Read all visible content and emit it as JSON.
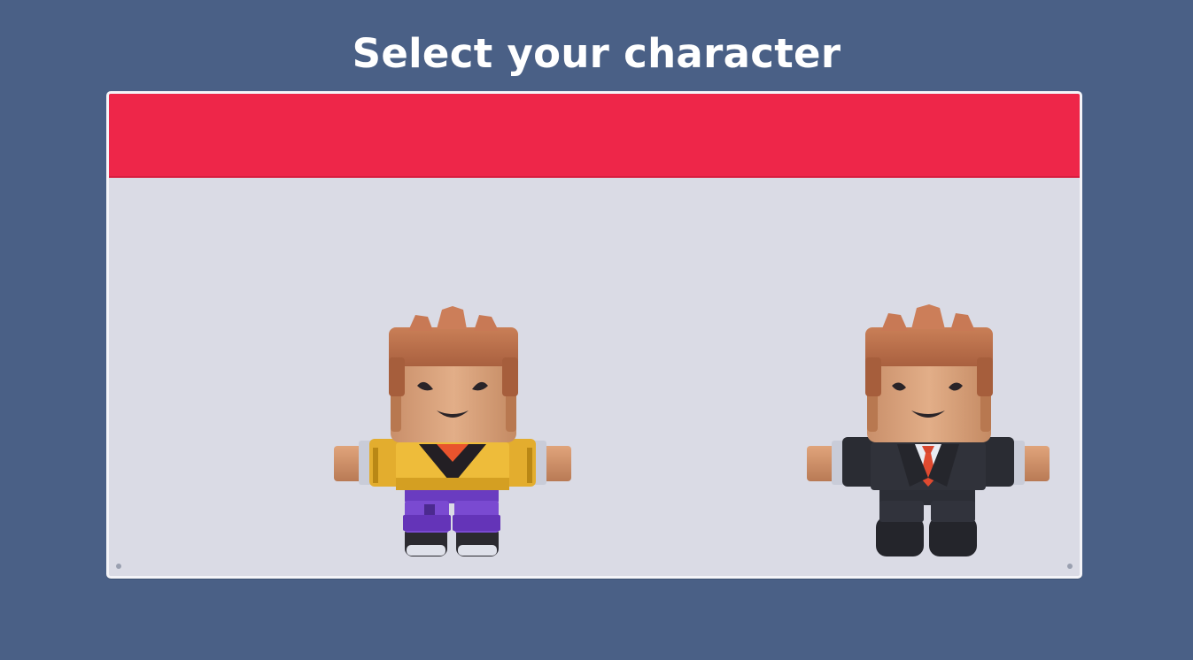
{
  "screen": {
    "title": "Select your character"
  },
  "colors": {
    "background": "#4a6086",
    "panel": "#dadbe5",
    "header": "#ee2649"
  },
  "characters": [
    {
      "icon": "casual-character-icon",
      "outfit": "yellow-jacket-purple-pants"
    },
    {
      "icon": "suit-character-icon",
      "outfit": "black-suit-red-tie"
    }
  ]
}
